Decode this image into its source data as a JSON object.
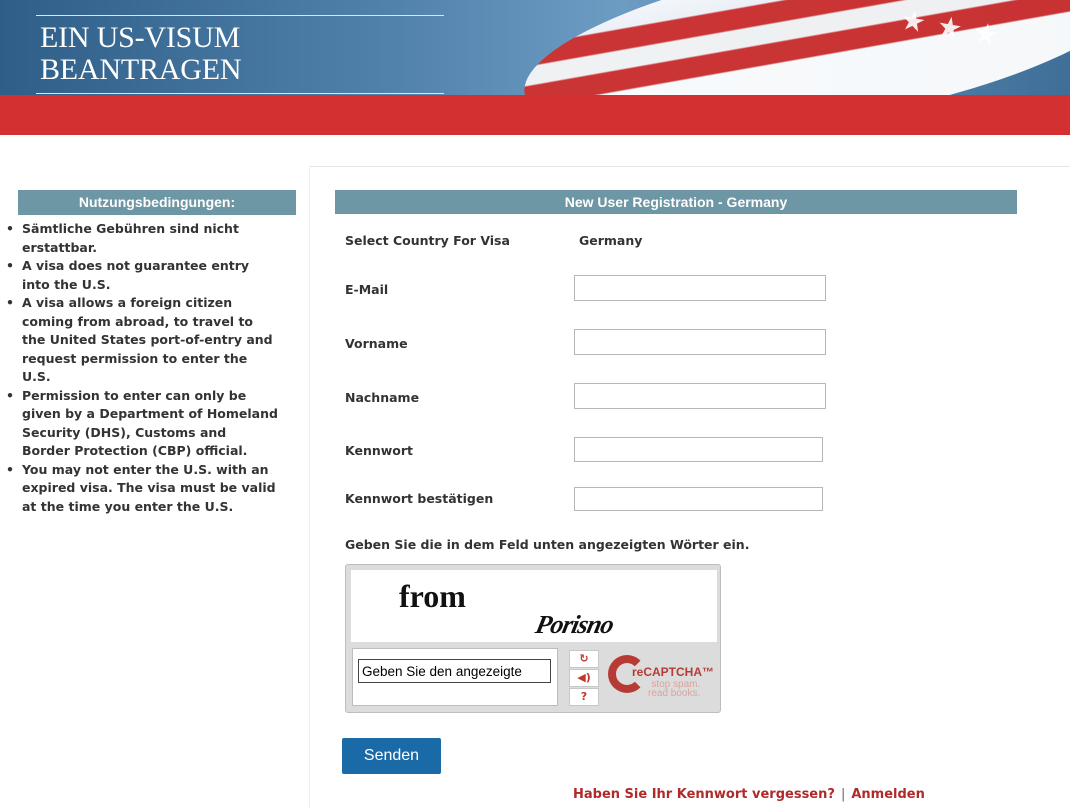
{
  "header": {
    "title_line1": "EIN US-VISUM",
    "title_line2": "BEANTRAGEN"
  },
  "terms": {
    "heading": "Nutzungsbedingungen:",
    "items": [
      "Sämtliche Gebühren sind nicht erstattbar.",
      "A visa does not guarantee entry into the U.S.",
      "A visa allows a foreign citizen coming from abroad, to travel to the United States port-of-entry and request permission to enter the U.S.",
      "Permission to enter can only be given by a Department of Homeland Security (DHS), Customs and Border Protection (CBP) official.",
      "You may not enter the U.S. with an expired visa. The visa must be valid at the time you enter the U.S."
    ]
  },
  "form": {
    "heading": "New User Registration - Germany",
    "country_label": "Select Country For Visa",
    "country_value": "Germany",
    "email_label": "E-Mail",
    "email_value": "",
    "firstname_label": "Vorname",
    "firstname_value": "",
    "lastname_label": "Nachname",
    "lastname_value": "",
    "password_label": "Kennwort",
    "password_value": "",
    "confirm_label": "Kennwort bestätigen",
    "confirm_value": "",
    "captcha_prompt": "Geben Sie die in dem Feld unten angezeigten Wörter ein.",
    "submit_label": "Senden"
  },
  "captcha": {
    "word1": "from",
    "word2": "Porisno",
    "answer_value": "Geben Sie den angezeigte",
    "brand": "reCAPTCHA™",
    "tagline_1": "stop spam.",
    "tagline_2": "read books.",
    "reload_icon": "reload-icon",
    "audio_icon": "audio-icon",
    "help_icon": "help-icon"
  },
  "links": {
    "forgot_password": "Haben Sie Ihr Kennwort vergessen?",
    "separator": "|",
    "login": "Anmelden"
  },
  "colors": {
    "red_bar": "#d33131",
    "heading_bg": "#6e97a5",
    "button_bg": "#1a6aa8",
    "link": "#b02a2a"
  }
}
